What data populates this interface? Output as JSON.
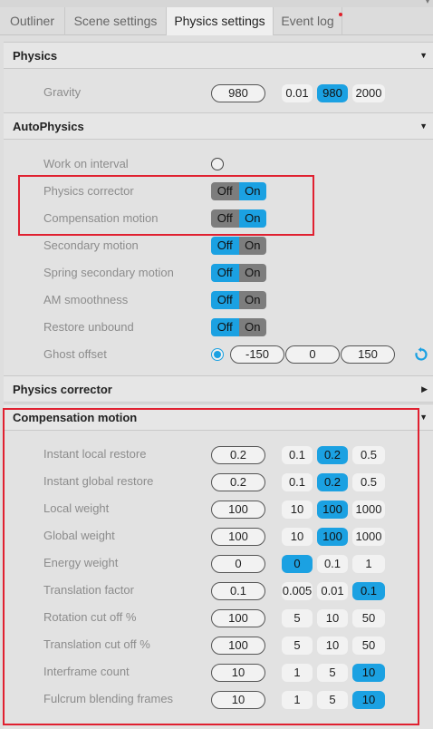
{
  "tabs": [
    {
      "label": "Outliner",
      "active": false
    },
    {
      "label": "Scene settings",
      "active": false
    },
    {
      "label": "Physics settings",
      "active": true
    },
    {
      "label": "Event log",
      "active": false
    }
  ],
  "colors": {
    "accent": "#1ba1e2",
    "highlight": "#e02030",
    "notification_dot": "#e0202a"
  },
  "physics": {
    "title": "Physics",
    "gravity": {
      "label": "Gravity",
      "value": "980",
      "presets": [
        "0.01",
        "980",
        "2000"
      ],
      "selected": 1
    }
  },
  "autophysics": {
    "title": "AutoPhysics",
    "work_on_interval": {
      "label": "Work on interval",
      "checked": false
    },
    "toggles": [
      {
        "label": "Physics corrector",
        "off": "Off",
        "on": "On",
        "state": "on"
      },
      {
        "label": "Compensation motion",
        "off": "Off",
        "on": "On",
        "state": "on"
      },
      {
        "label": "Secondary motion",
        "off": "Off",
        "on": "On",
        "state": "off"
      },
      {
        "label": "Spring secondary motion",
        "off": "Off",
        "on": "On",
        "state": "off"
      },
      {
        "label": "AM smoothness",
        "off": "Off",
        "on": "On",
        "state": "off"
      },
      {
        "label": "Restore unbound",
        "off": "Off",
        "on": "On",
        "state": "off"
      }
    ],
    "ghost_offset": {
      "label": "Ghost offset",
      "checked": true,
      "values": [
        "-150",
        "0",
        "150"
      ],
      "icon": "reset-icon"
    }
  },
  "physics_corrector": {
    "title": "Physics corrector",
    "collapsed": true
  },
  "compensation_motion": {
    "title": "Compensation motion",
    "rows": [
      {
        "label": "Instant local restore",
        "value": "0.2",
        "presets": [
          "0.1",
          "0.2",
          "0.5"
        ],
        "selected": 1
      },
      {
        "label": "Instant global restore",
        "value": "0.2",
        "presets": [
          "0.1",
          "0.2",
          "0.5"
        ],
        "selected": 1
      },
      {
        "label": "Local weight",
        "value": "100",
        "presets": [
          "10",
          "100",
          "1000"
        ],
        "selected": 1
      },
      {
        "label": "Global weight",
        "value": "100",
        "presets": [
          "10",
          "100",
          "1000"
        ],
        "selected": 1
      },
      {
        "label": "Energy weight",
        "value": "0",
        "presets": [
          "0",
          "0.1",
          "1"
        ],
        "selected": 0
      },
      {
        "label": "Translation factor",
        "value": "0.1",
        "presets": [
          "0.005",
          "0.01",
          "0.1"
        ],
        "selected": 2
      },
      {
        "label": "Rotation cut off %",
        "value": "100",
        "presets": [
          "5",
          "10",
          "50"
        ],
        "selected": -1
      },
      {
        "label": "Translation cut off %",
        "value": "100",
        "presets": [
          "5",
          "10",
          "50"
        ],
        "selected": -1
      },
      {
        "label": "Interframe count",
        "value": "10",
        "presets": [
          "1",
          "5",
          "10"
        ],
        "selected": 2
      },
      {
        "label": "Fulcrum blending frames",
        "value": "10",
        "presets": [
          "1",
          "5",
          "10"
        ],
        "selected": 2
      }
    ]
  }
}
